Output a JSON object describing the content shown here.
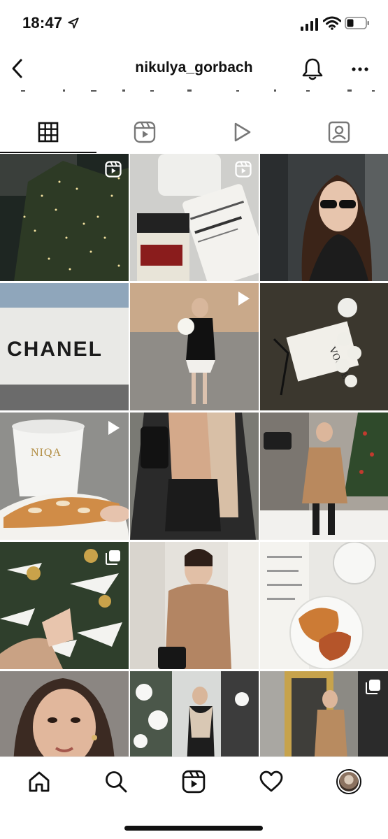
{
  "status_bar": {
    "time": "18:47",
    "icons": [
      "location-arrow-icon",
      "signal-icon",
      "wifi-icon",
      "battery-icon"
    ]
  },
  "header": {
    "username": "nikulya_gorbach",
    "icons": [
      "chevron-left-icon",
      "bell-icon",
      "more-icon"
    ]
  },
  "tabs": [
    {
      "name": "posts-grid",
      "icon": "grid-icon",
      "active": true
    },
    {
      "name": "reels",
      "icon": "reels-icon",
      "active": false
    },
    {
      "name": "videos",
      "icon": "play-icon",
      "active": false
    },
    {
      "name": "tagged",
      "icon": "person-tag-icon",
      "active": false
    }
  ],
  "grid": {
    "images": [
      {
        "row": 1,
        "col": 1,
        "label": "illuminated-trees-night",
        "badge": "reels-icon"
      },
      {
        "row": 1,
        "col": 2,
        "label": "skincare-products",
        "badge": "reels-icon"
      },
      {
        "row": 1,
        "col": 3,
        "label": "woman-sunglasses-portrait",
        "badge": ""
      },
      {
        "row": 2,
        "col": 1,
        "label": "storefront-sign",
        "badge": "",
        "sign_text": "CHANEL"
      },
      {
        "row": 2,
        "col": 2,
        "label": "woman-walking-with-flowers",
        "badge": "play-icon"
      },
      {
        "row": 2,
        "col": 3,
        "label": "bouquet-and-magazine",
        "badge": "",
        "magazine_text": "VOGUE"
      },
      {
        "row": 3,
        "col": 1,
        "label": "coffee-and-croissant",
        "badge": "play-icon",
        "cup_text": "NIQA"
      },
      {
        "row": 3,
        "col": 2,
        "label": "leather-jacket-outfit",
        "badge": ""
      },
      {
        "row": 3,
        "col": 3,
        "label": "woman-on-snowy-terrace",
        "badge": ""
      },
      {
        "row": 4,
        "col": 1,
        "label": "christmas-tree-hand",
        "badge": "multi-photo-icon"
      },
      {
        "row": 4,
        "col": 2,
        "label": "woman-teddy-coat",
        "badge": ""
      },
      {
        "row": 4,
        "col": 3,
        "label": "breakfast-croissants",
        "badge": ""
      },
      {
        "row": 5,
        "col": 1,
        "label": "selfie-portrait",
        "badge": ""
      },
      {
        "row": 5,
        "col": 2,
        "label": "woman-snowy-street",
        "badge": ""
      },
      {
        "row": 5,
        "col": 3,
        "label": "woman-by-storefront",
        "badge": "multi-photo-icon"
      }
    ]
  },
  "bottom_nav": {
    "items": [
      "home-icon",
      "search-icon",
      "reels-icon",
      "heart-icon",
      "profile-avatar"
    ]
  },
  "colors": {
    "text": "#111111",
    "background": "#ffffff",
    "divider": "#e6e6e6"
  }
}
